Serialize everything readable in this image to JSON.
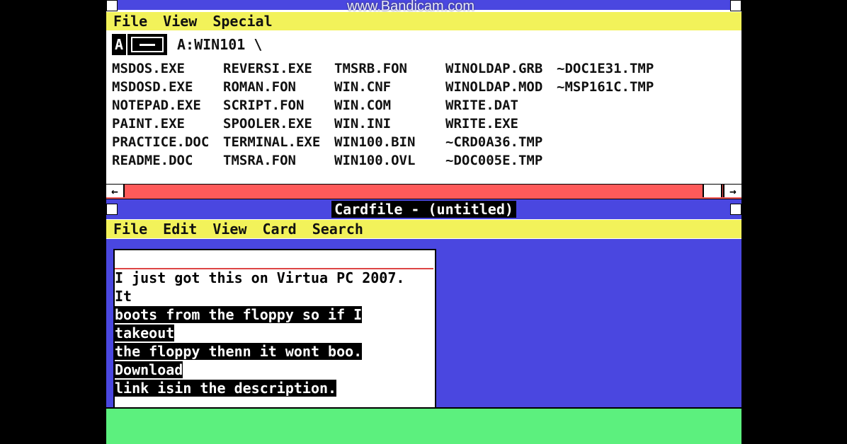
{
  "watermark": "www.Bandicam.com",
  "file_manager": {
    "menu": [
      "File",
      "View",
      "Special"
    ],
    "drive_letter": "A",
    "path": "A:WIN101 \\",
    "files": [
      "MSDOS.EXE",
      "MSDOSD.EXE",
      "NOTEPAD.EXE",
      "PAINT.EXE",
      "PRACTICE.DOC",
      "README.DOC",
      "REVERSI.EXE",
      "ROMAN.FON",
      "SCRIPT.FON",
      "SPOOLER.EXE",
      "TERMINAL.EXE",
      "TMSRA.FON",
      "TMSRB.FON",
      "WIN.CNF",
      "WIN.COM",
      "WIN.INI",
      "WIN100.BIN",
      "WIN100.OVL",
      "WINOLDAP.GRB",
      "WINOLDAP.MOD",
      "WRITE.DAT",
      "WRITE.EXE",
      "~CRD0A36.TMP",
      "~DOC005E.TMP",
      "~DOC1E31.TMP",
      "~MSP161C.TMP"
    ],
    "scroll_left_glyph": "←",
    "scroll_right_glyph": "→"
  },
  "cardfile": {
    "title": "Cardfile - (untitled)",
    "menu": [
      "File",
      "Edit",
      "View",
      "Card",
      "Search"
    ],
    "card_text_plain": "I just got this on Virtua PC 2007. It",
    "card_text_selected": [
      "boots from the floppy so if I takeout",
      "the floppy thenn it wont boo. Download",
      "link isin the description."
    ]
  },
  "colors": {
    "title_bar": "#4a47e0",
    "menu_bar": "#f2f25a",
    "scroll_bar": "#ff5a5a",
    "bottom_area": "#5cf07e"
  }
}
